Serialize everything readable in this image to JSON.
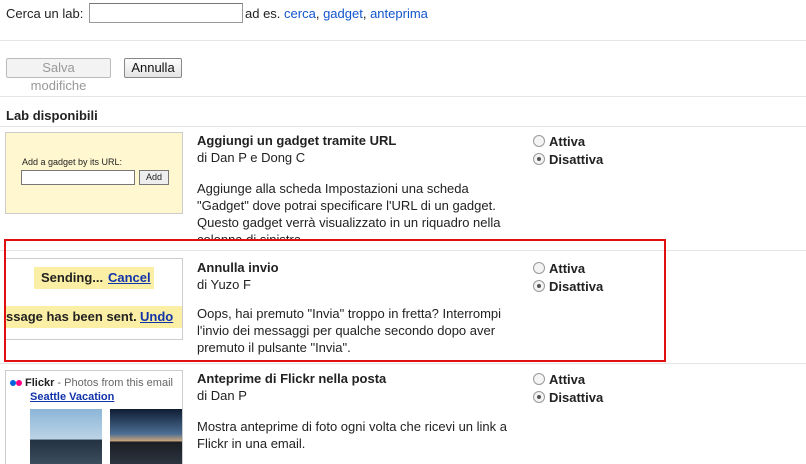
{
  "search": {
    "label": "Cerca un lab:",
    "value": "",
    "placeholder": "",
    "example_prefix": "ad es.",
    "examples": [
      "cerca",
      "gadget",
      "anteprima"
    ]
  },
  "actions": {
    "save_label": "Salva modifiche",
    "cancel_label": "Annulla"
  },
  "section_title": "Lab disponibili",
  "labs": [
    {
      "title": "Aggiungi un gadget tramite URL",
      "author": "di Dan P e Dong C",
      "description": "Aggiunge alla scheda Impostazioni una scheda \"Gadget\" dove potrai specificare l'URL di un gadget. Questo gadget verrà visualizzato in un riquadro nella colonna di sinistra.",
      "enable_label": "Attiva",
      "disable_label": "Disattiva",
      "state": "disabled",
      "preview": {
        "label": "Add a gadget by its URL:",
        "button": "Add"
      }
    },
    {
      "title": "Annulla invio",
      "author": "di Yuzo F",
      "description": "Oops, hai premuto \"Invia\" troppo in fretta? Interrompi l'invio dei messaggi per qualche secondo dopo aver premuto il pulsante \"Invia\".",
      "enable_label": "Attiva",
      "disable_label": "Disattiva",
      "state": "disabled",
      "preview": {
        "sending": "Sending...",
        "cancel": "Cancel",
        "sent": "ssage has been sent.",
        "undo": "Undo"
      }
    },
    {
      "title": "Anteprime di Flickr nella posta",
      "author": "di Dan P",
      "description": "Mostra anteprime di foto ogni volta che ricevi un link a Flickr in una email.",
      "enable_label": "Attiva",
      "disable_label": "Disattiva",
      "state": "disabled",
      "preview": {
        "brand": "Flickr",
        "subtitle": "- Photos from this email",
        "album": "Seattle Vacation"
      }
    }
  ],
  "colors": {
    "link": "#1155cc",
    "highlight_border": "#e01010",
    "preview_bg": "#fff7cf",
    "undo_bar": "#fbeea5"
  }
}
